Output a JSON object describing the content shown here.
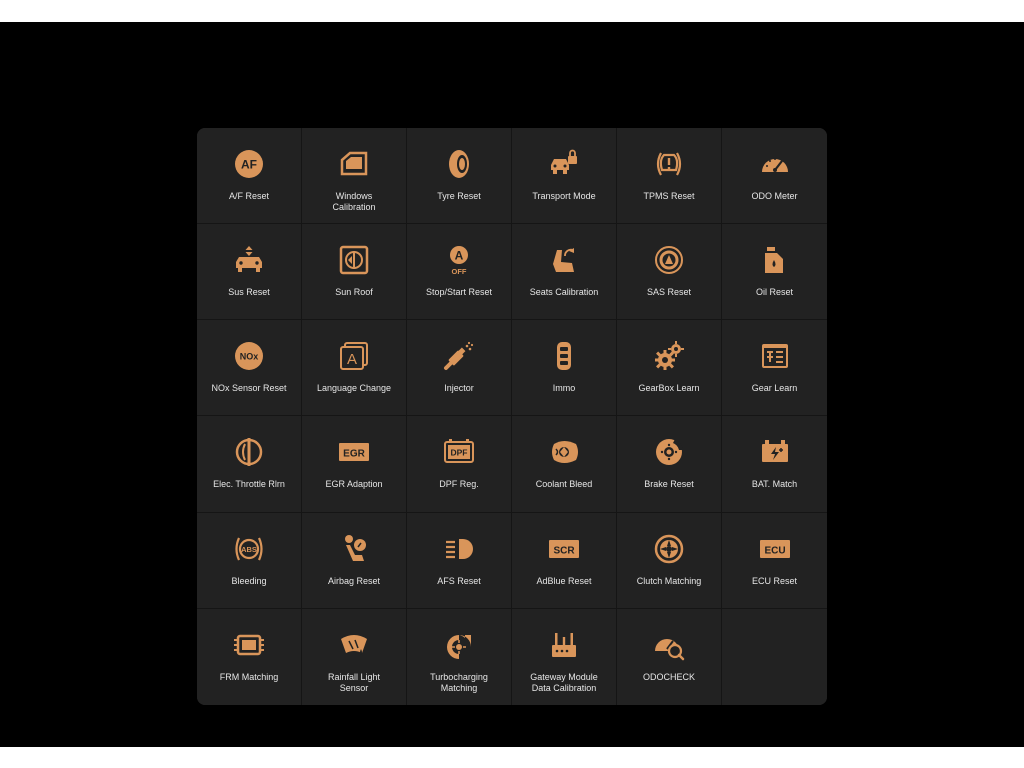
{
  "colors": {
    "accent": "#D9955A",
    "tile_bg": "#222222",
    "panel_bg": "#1F1F1F",
    "text": "#E6E6E6"
  },
  "tiles": [
    {
      "label": "A/F Reset",
      "icon": "af-icon",
      "glyph": "AF"
    },
    {
      "label": "Windows\nCalibration",
      "icon": "window-icon"
    },
    {
      "label": "Tyre Reset",
      "icon": "tyre-icon"
    },
    {
      "label": "Transport Mode",
      "icon": "car-lock-icon"
    },
    {
      "label": "TPMS Reset",
      "icon": "tpms-icon"
    },
    {
      "label": "ODO Meter",
      "icon": "speedometer-icon"
    },
    {
      "label": "Sus Reset",
      "icon": "suspension-icon"
    },
    {
      "label": "Sun Roof",
      "icon": "sunroof-icon"
    },
    {
      "label": "Stop/Start Reset",
      "icon": "auto-stop-off-icon",
      "glyph": "A",
      "glyph2": "OFF"
    },
    {
      "label": "Seats Calibration",
      "icon": "seat-icon"
    },
    {
      "label": "SAS Reset",
      "icon": "steering-sensor-icon"
    },
    {
      "label": "Oil Reset",
      "icon": "oil-can-icon"
    },
    {
      "label": "NOx Sensor Reset",
      "icon": "nox-icon",
      "glyph": "NOx"
    },
    {
      "label": "Language Change",
      "icon": "language-icon",
      "glyph": "A"
    },
    {
      "label": "Injector",
      "icon": "injector-icon"
    },
    {
      "label": "Immo",
      "icon": "key-fob-icon"
    },
    {
      "label": "GearBox Learn",
      "icon": "gears-icon"
    },
    {
      "label": "Gear Learn",
      "icon": "gear-learn-icon"
    },
    {
      "label": "Elec. Throttle Rlrn",
      "icon": "throttle-icon"
    },
    {
      "label": "EGR Adaption",
      "icon": "egr-icon",
      "glyph": "EGR"
    },
    {
      "label": "DPF Reg.",
      "icon": "dpf-icon",
      "glyph": "DPF"
    },
    {
      "label": "Coolant Bleed",
      "icon": "coolant-icon"
    },
    {
      "label": "Brake Reset",
      "icon": "brake-disc-icon"
    },
    {
      "label": "BAT. Match",
      "icon": "battery-icon"
    },
    {
      "label": "Bleeding",
      "icon": "abs-icon",
      "glyph": "ABS"
    },
    {
      "label": "Airbag Reset",
      "icon": "airbag-icon"
    },
    {
      "label": "AFS Reset",
      "icon": "headlight-icon"
    },
    {
      "label": "AdBlue Reset",
      "icon": "scr-icon",
      "glyph": "SCR"
    },
    {
      "label": "Clutch Matching",
      "icon": "clutch-icon"
    },
    {
      "label": "ECU Reset",
      "icon": "ecu-icon",
      "glyph": "ECU"
    },
    {
      "label": "FRM Matching",
      "icon": "frm-module-icon"
    },
    {
      "label": "Rainfall Light\nSensor",
      "icon": "rain-sensor-icon"
    },
    {
      "label": "Turbocharging\nMatching",
      "icon": "turbo-icon"
    },
    {
      "label": "Gateway Module\nData Calibration",
      "icon": "gateway-icon"
    },
    {
      "label": "ODOCHECK",
      "icon": "odo-check-icon"
    }
  ]
}
